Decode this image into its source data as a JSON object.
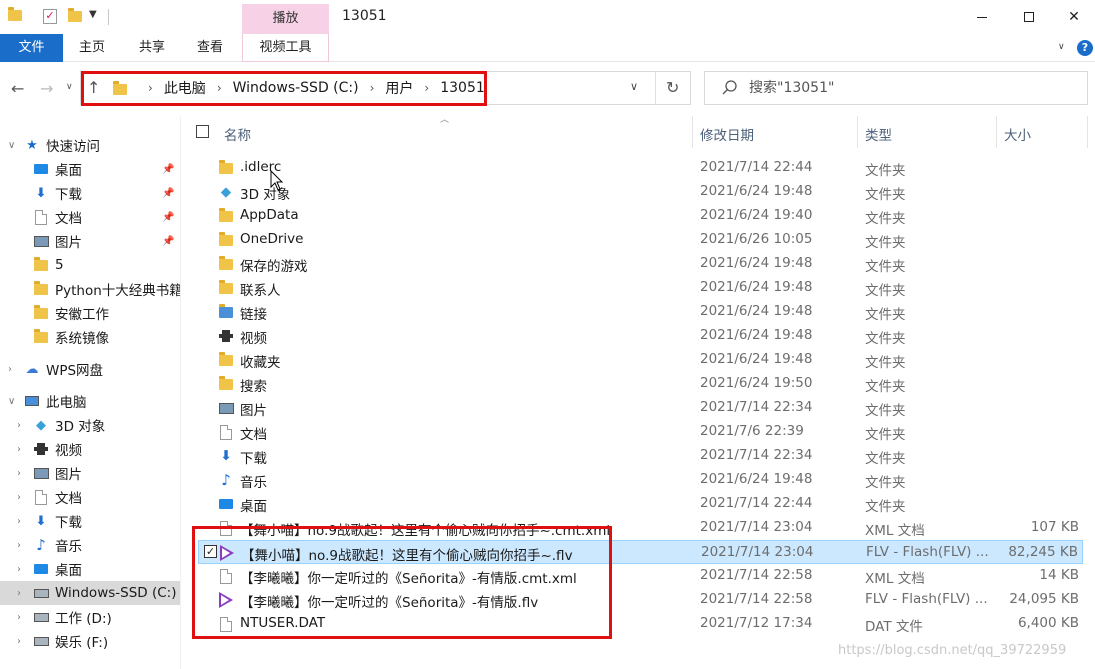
{
  "titlebar": {
    "context_tab": "播放",
    "title": "13051"
  },
  "ribbon": {
    "tabs": [
      "文件",
      "主页",
      "共享",
      "查看",
      "视频工具"
    ]
  },
  "address": {
    "crumbs": [
      "此电脑",
      "Windows-SSD (C:)",
      "用户",
      "13051"
    ]
  },
  "search": {
    "placeholder": "搜索\"13051\""
  },
  "sidebar": {
    "items": [
      {
        "label": "快速访问",
        "icon": "star-icon"
      },
      {
        "label": "桌面",
        "icon": "desktop-icon",
        "pinned": true
      },
      {
        "label": "下载",
        "icon": "download-icon",
        "pinned": true
      },
      {
        "label": "文档",
        "icon": "document-icon",
        "pinned": true
      },
      {
        "label": "图片",
        "icon": "pictures-icon",
        "pinned": true
      },
      {
        "label": "5",
        "icon": "folder-icon"
      },
      {
        "label": "Python十大经典书籍",
        "icon": "folder-icon"
      },
      {
        "label": "安徽工作",
        "icon": "folder-icon"
      },
      {
        "label": "系统镜像",
        "icon": "folder-icon"
      },
      {
        "label": "WPS网盘",
        "icon": "cloud-icon"
      },
      {
        "label": "此电脑",
        "icon": "computer-icon"
      },
      {
        "label": "3D 对象",
        "icon": "3d-objects-icon"
      },
      {
        "label": "视频",
        "icon": "video-icon"
      },
      {
        "label": "图片",
        "icon": "pictures-icon"
      },
      {
        "label": "文档",
        "icon": "document-icon"
      },
      {
        "label": "下载",
        "icon": "download-icon"
      },
      {
        "label": "音乐",
        "icon": "music-icon"
      },
      {
        "label": "桌面",
        "icon": "desktop-icon"
      },
      {
        "label": "Windows-SSD (C:)",
        "icon": "drive-icon",
        "selected": true
      },
      {
        "label": "工作 (D:)",
        "icon": "drive-icon"
      },
      {
        "label": "娱乐 (F:)",
        "icon": "drive-icon"
      }
    ]
  },
  "columns": {
    "name": "名称",
    "modified": "修改日期",
    "type": "类型",
    "size": "大小"
  },
  "files": [
    {
      "name": ".idlerc",
      "date": "2021/7/14 22:44",
      "type": "文件夹",
      "size": "",
      "icon": "folder-icon"
    },
    {
      "name": "3D 对象",
      "date": "2021/6/24 19:48",
      "type": "文件夹",
      "size": "",
      "icon": "3d-objects-icon"
    },
    {
      "name": "AppData",
      "date": "2021/6/24 19:40",
      "type": "文件夹",
      "size": "",
      "icon": "folder-icon"
    },
    {
      "name": "OneDrive",
      "date": "2021/6/26 10:05",
      "type": "文件夹",
      "size": "",
      "icon": "onedrive-icon"
    },
    {
      "name": "保存的游戏",
      "date": "2021/6/24 19:48",
      "type": "文件夹",
      "size": "",
      "icon": "saved-games-icon"
    },
    {
      "name": "联系人",
      "date": "2021/6/24 19:48",
      "type": "文件夹",
      "size": "",
      "icon": "contacts-icon"
    },
    {
      "name": "链接",
      "date": "2021/6/24 19:48",
      "type": "文件夹",
      "size": "",
      "icon": "links-icon"
    },
    {
      "name": "视频",
      "date": "2021/6/24 19:48",
      "type": "文件夹",
      "size": "",
      "icon": "video-icon"
    },
    {
      "name": "收藏夹",
      "date": "2021/6/24 19:48",
      "type": "文件夹",
      "size": "",
      "icon": "favorites-icon"
    },
    {
      "name": "搜索",
      "date": "2021/6/24 19:50",
      "type": "文件夹",
      "size": "",
      "icon": "search-folder-icon"
    },
    {
      "name": "图片",
      "date": "2021/7/14 22:34",
      "type": "文件夹",
      "size": "",
      "icon": "pictures-icon"
    },
    {
      "name": "文档",
      "date": "2021/7/6 22:39",
      "type": "文件夹",
      "size": "",
      "icon": "document-icon"
    },
    {
      "name": "下载",
      "date": "2021/7/14 22:34",
      "type": "文件夹",
      "size": "",
      "icon": "download-icon"
    },
    {
      "name": "音乐",
      "date": "2021/6/24 19:48",
      "type": "文件夹",
      "size": "",
      "icon": "music-icon"
    },
    {
      "name": "桌面",
      "date": "2021/7/14 22:44",
      "type": "文件夹",
      "size": "",
      "icon": "desktop-icon"
    },
    {
      "name": "【舞小喵】no.9战歌起！这里有个偷心贼向你招手~.cmt.xml",
      "date": "2021/7/14 23:04",
      "type": "XML 文档",
      "size": "107 KB",
      "icon": "xml-file-icon"
    },
    {
      "name": "【舞小喵】no.9战歌起！这里有个偷心贼向你招手~.flv",
      "date": "2021/7/14 23:04",
      "type": "FLV - Flash(FLV) ...",
      "size": "82,245 KB",
      "icon": "flv-file-icon",
      "selected": true
    },
    {
      "name": "【李曦曦】你一定听过的《Señorita》-有情版.cmt.xml",
      "date": "2021/7/14 22:58",
      "type": "XML 文档",
      "size": "14 KB",
      "icon": "xml-file-icon"
    },
    {
      "name": "【李曦曦】你一定听过的《Señorita》-有情版.flv",
      "date": "2021/7/14 22:58",
      "type": "FLV - Flash(FLV) ...",
      "size": "24,095 KB",
      "icon": "flv-file-icon"
    },
    {
      "name": "NTUSER.DAT",
      "date": "2021/7/12 17:34",
      "type": "DAT 文件",
      "size": "6,400 KB",
      "icon": "dat-file-icon"
    }
  ],
  "watermark": "https://blog.csdn.net/qq_39722959",
  "colors": {
    "accent": "#1a6ec9",
    "context_tab": "#f7d2e6",
    "selection": "#cce8ff",
    "highlight_box": "#e01010",
    "folder": "#f0c349"
  }
}
